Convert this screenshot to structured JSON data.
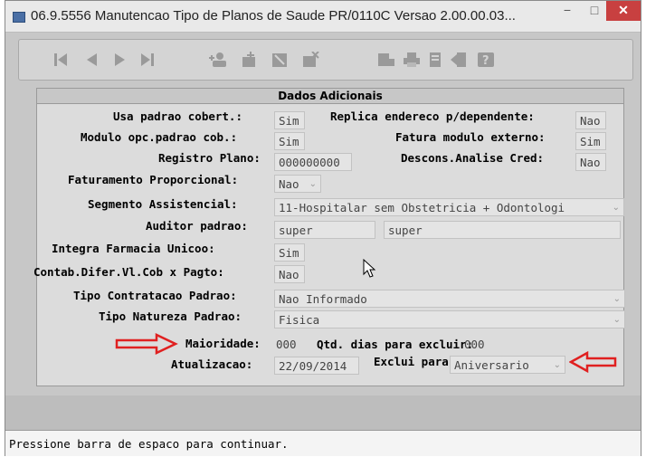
{
  "window": {
    "title": "06.9.5556 Manutencao  Tipo de Planos de Saude PR/0110C Versao 2.00.00.03...",
    "minimize": "−",
    "maximize": "□",
    "close": "✕"
  },
  "toolbar": {
    "icons": [
      "first-record-icon",
      "prev-record-icon",
      "next-record-icon",
      "last-record-icon",
      "add-user-icon",
      "add-icon",
      "edit-icon",
      "delete-icon",
      "filter-icon",
      "print-icon",
      "copy-icon",
      "exit-icon",
      "help-icon"
    ]
  },
  "panel": {
    "title": "Dados Adicionais",
    "usa_padrao_label": "Usa padrao cobert.:",
    "usa_padrao_value": "Sim",
    "replica_label": "Replica endereco p/dependente:",
    "replica_value": "Nao",
    "modulo_label": "Modulo opc.padrao cob.:",
    "modulo_value": "Sim",
    "fatura_label": "Fatura modulo externo:",
    "fatura_value": "Sim",
    "registro_label": "Registro Plano:",
    "registro_value": "000000000",
    "descons_label": "Descons.Analise Cred:",
    "descons_value": "Nao",
    "faturamento_label": "Faturamento Proporcional:",
    "faturamento_value": "Nao",
    "segmento_label": "Segmento Assistencial:",
    "segmento_value": "11-Hospitalar sem Obstetricia + Odontologi",
    "auditor_label": "Auditor padrao:",
    "auditor_value1": "super",
    "auditor_value2": "super",
    "integra_label": "Integra Farmacia Unicoo:",
    "integra_value": "Sim",
    "contab_label": "Contab.Difer.Vl.Cob x Pagto:",
    "contab_value": "Nao",
    "tipo_contratacao_label": "Tipo Contratacao Padrao:",
    "tipo_contratacao_value": "Nao Informado",
    "tipo_natureza_label": "Tipo Natureza Padrao:",
    "tipo_natureza_value": "Fisica",
    "maioridade_label": "Maioridade:",
    "maioridade_value": "000",
    "qtd_dias_label": "Qtd. dias para excluir:",
    "qtd_dias_value": "000",
    "atualizacao_label": "Atualizacao:",
    "atualizacao_value": "22/09/2014",
    "exclui_label": "Exclui para:",
    "exclui_value": "Aniversario"
  },
  "status": {
    "message": "Pressione barra de espaco para continuar."
  },
  "colors": {
    "annotation_arrow": "#e02020",
    "close_button": "#c84040"
  }
}
